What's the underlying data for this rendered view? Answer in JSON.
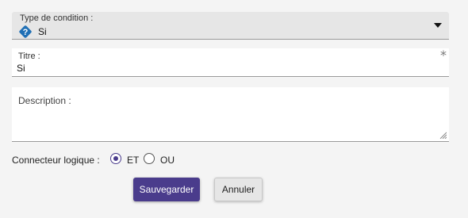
{
  "condition_type": {
    "label": "Type de condition :",
    "value": "Si",
    "icon": "question-diamond-icon"
  },
  "title_field": {
    "label": "Titre :",
    "value": "Si",
    "required_marker": "*"
  },
  "description_field": {
    "label": "Description :",
    "value": ""
  },
  "logical_connector": {
    "label": "Connecteur logique :",
    "options": [
      {
        "label": "ET",
        "selected": true
      },
      {
        "label": "OU",
        "selected": false
      }
    ]
  },
  "buttons": {
    "save_label": "Sauvegarder",
    "cancel_label": "Annuler"
  },
  "colors": {
    "accent": "#4a3c8c",
    "icon_blue": "#1f6fb5"
  }
}
